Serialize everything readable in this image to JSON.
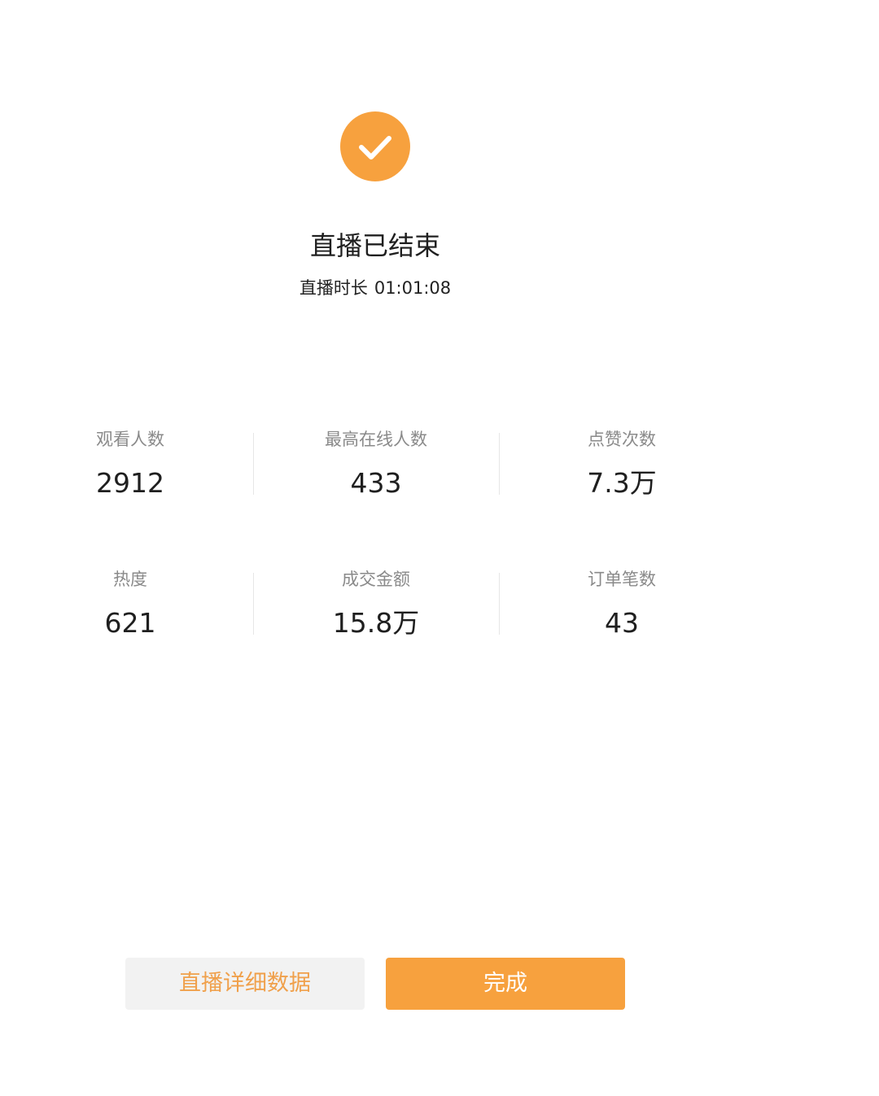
{
  "status": {
    "icon": "check-icon",
    "accent_color": "#f7a13e",
    "title": "直播已结束",
    "duration_label": "直播时长",
    "duration_value": "01:01:08"
  },
  "stats": [
    {
      "label": "观看人数",
      "value": "2912"
    },
    {
      "label": "最高在线人数",
      "value": "433"
    },
    {
      "label": "点赞次数",
      "value": "7.3万"
    },
    {
      "label": "热度",
      "value": "621"
    },
    {
      "label": "成交金额",
      "value": "15.8万"
    },
    {
      "label": "订单笔数",
      "value": "43"
    }
  ],
  "actions": {
    "detail_label": "直播详细数据",
    "done_label": "完成"
  }
}
